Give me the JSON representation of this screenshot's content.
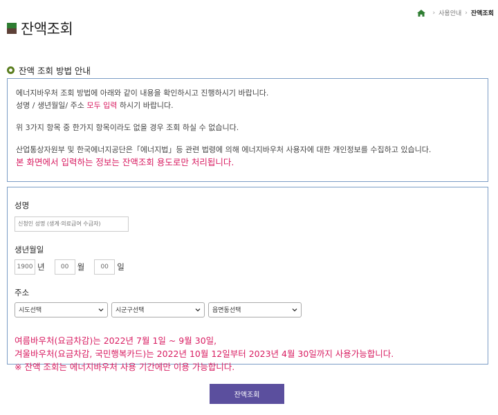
{
  "breadcrumb": {
    "item1": "사용안내",
    "current": "잔액조회"
  },
  "page": {
    "title": "잔액조회"
  },
  "guide": {
    "heading": "잔액 조회 방법 안내",
    "line1": "에너지바우처 조회 방법에 아래와 같이 내용을 확인하시고 진행하시기 바랍니다.",
    "line2_pre": "성명 / 생년월일/ 주소 ",
    "line2_emph": "모두 입력",
    "line2_post": " 하시기 바랍니다.",
    "line3": "위 3가지 항목 중 한가지 항목이라도 없을 경우 조회 하실 수 없습니다.",
    "line4": "산업통상자원부 및 한국에너지공단은「에너지법」등 관련 법령에 의해 에너지바우처 사용자에 대한 개인정보를 수집하고 있습니다.",
    "line5": "본 화면에서 입력하는 정보는 잔액조회 용도로만 처리됩니다."
  },
  "form": {
    "name_label": "성명",
    "name_placeholder": "신청인 성명 (생계·의료급여 수급자)",
    "birth_label": "생년월일",
    "year_value": "1900",
    "year_unit": "년",
    "month_value": "00",
    "month_unit": "월",
    "day_value": "00",
    "day_unit": "일",
    "address_label": "주소",
    "sido": "시도선택",
    "sigungu": "시군구선택",
    "eupmyeondong": "읍면동선택",
    "notice1": "여름바우처(요금차감)는 2022년 7월 1일 ~ 9월 30일,",
    "notice2": "겨울바우처(요금차감, 국민행복카드)는 2022년 10월 12일부터 2023년 4월 30일까지 사용가능합니다.",
    "notice3": "※ 잔액 조회는 에너지바우처 사용 기간에만 이용 가능합니다."
  },
  "actions": {
    "submit": "잔액조회"
  },
  "colors": {
    "accent": "#5b4f9e",
    "highlight": "#d81b60",
    "border": "#7a9cc5"
  }
}
